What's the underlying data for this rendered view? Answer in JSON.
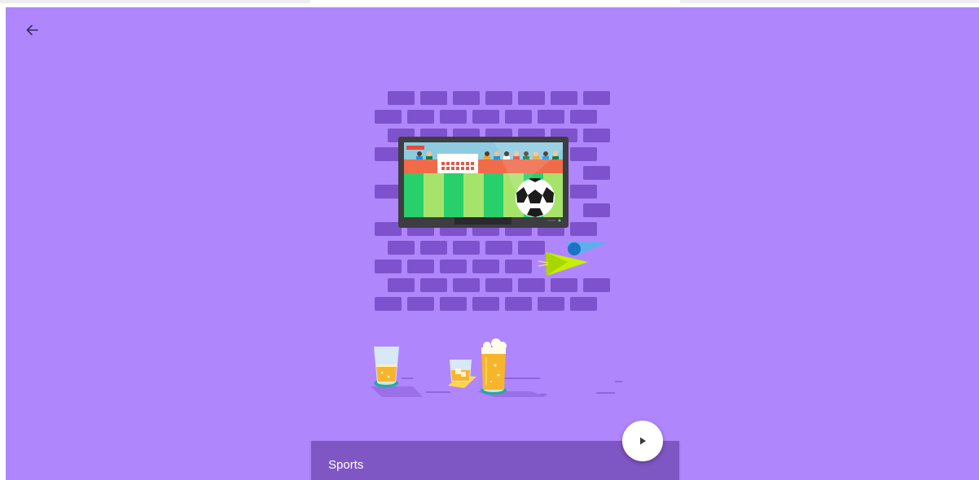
{
  "app": {
    "caption_title": "Sports"
  },
  "icons": {
    "back": "arrow-left-icon",
    "play": "play-icon"
  },
  "colors": {
    "background": "#b086fc",
    "bricks": "#7d52cc",
    "caption_bar": "#7f57c4",
    "play_button": "#ffffff"
  }
}
